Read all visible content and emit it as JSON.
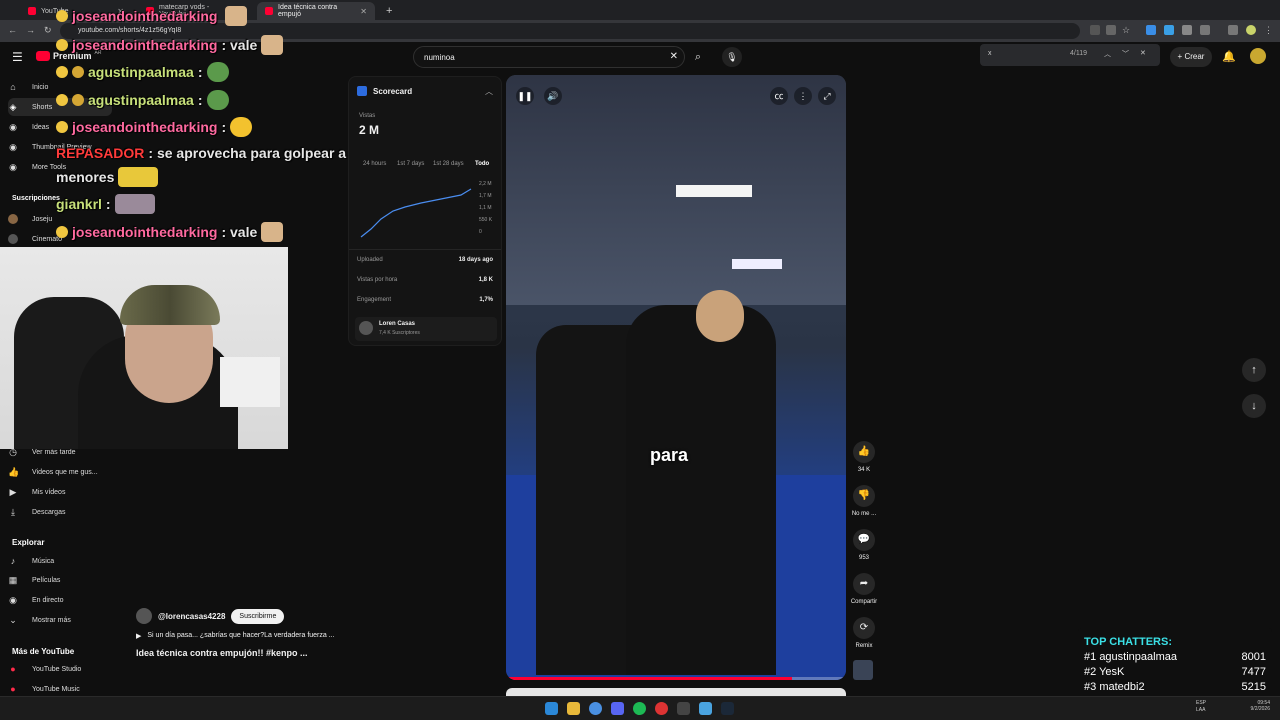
{
  "browser": {
    "tabs": [
      {
        "label": "YouTube"
      },
      {
        "label": "matecarp vods - YouTube"
      },
      {
        "label": "Idea técnica contra empujó"
      }
    ],
    "url": "youtube.com/shorts/4z1z56gYqI8",
    "find": {
      "query": "x",
      "count": "4/119"
    }
  },
  "yt": {
    "logo": "Premium",
    "logo_sup": "AR",
    "search": "numinoa",
    "create": "Crear"
  },
  "sidebar": {
    "items": [
      {
        "label": "Inicio",
        "icon": "home-icon"
      },
      {
        "label": "Shorts",
        "icon": "shorts-icon"
      },
      {
        "label": "Ideas",
        "icon": "ideas-icon"
      },
      {
        "label": "Thumbnail Preview",
        "icon": "ext-icon"
      },
      {
        "label": "More Tools",
        "icon": "ext-icon"
      }
    ],
    "subs_head": "Suscripciones",
    "subs": [
      {
        "label": "Joseju"
      },
      {
        "label": "Cinemato"
      }
    ],
    "you": [
      {
        "label": "Ver más tarde"
      },
      {
        "label": "Videos que me gus..."
      },
      {
        "label": "Mis vídeos"
      },
      {
        "label": "Descargas"
      }
    ],
    "explore_head": "Explorar",
    "explore": [
      {
        "label": "Música"
      },
      {
        "label": "Películas"
      },
      {
        "label": "En directo"
      },
      {
        "label": "Mostrar más"
      }
    ],
    "more_head": "Más de YouTube",
    "more": [
      {
        "label": "YouTube Studio"
      },
      {
        "label": "YouTube Music"
      }
    ]
  },
  "chat": [
    {
      "user": "joseandointhedarking",
      "msg": ""
    },
    {
      "user": "joseandointhedarking",
      "msg": ": vale"
    },
    {
      "user": "agustinpaalmaa",
      "msg": ":"
    },
    {
      "user": "agustinpaalmaa",
      "msg": ":"
    },
    {
      "user": "joseandointhedarking",
      "msg": ":"
    },
    {
      "user": "REPASADOR",
      "msg": ": se aprovecha para golpear a"
    },
    {
      "user": "",
      "msg": "menores"
    },
    {
      "user": "giankrl",
      "msg": ":"
    },
    {
      "user": "joseandointhedarking",
      "msg": ": vale"
    }
  ],
  "scorecard": {
    "title": "Scorecard",
    "views_label": "Vistas",
    "views": "2 M",
    "ranges": [
      "24 hours",
      "1st 7 days",
      "1st 28 days",
      "Todo"
    ],
    "y_ticks": [
      "2,2 M",
      "1,7 M",
      "1,1 M",
      "550 K",
      "0"
    ],
    "rows": [
      {
        "label": "Uploaded",
        "value": "18 days ago"
      },
      {
        "label": "Vistas por hora",
        "value": "1,8 K"
      },
      {
        "label": "Engagement",
        "value": "1,7%"
      }
    ],
    "channel": "Loren Casas",
    "channel_subs": "7,4 K Suscriptores"
  },
  "video": {
    "caption": "para",
    "progress": 0.84
  },
  "actions": [
    {
      "label": "34 K",
      "icon": "like-icon"
    },
    {
      "label": "No me ...",
      "icon": "dislike-icon"
    },
    {
      "label": "953",
      "icon": "comment-icon"
    },
    {
      "label": "Compartir",
      "icon": "share-icon"
    },
    {
      "label": "Remix",
      "icon": "remix-icon"
    }
  ],
  "channel": {
    "handle": "@lorencasas4228",
    "subscribe": "Suscribirme",
    "description": "Si un día pasa... ¿sabrías que hacer?La verdadera fuerza ...",
    "title": "Idea técnica contra empujón!! #kenpo ..."
  },
  "top_chatters": {
    "title": "TOP CHATTERS:",
    "rows": [
      {
        "rank": "#1",
        "name": "agustinpaalmaa",
        "count": "8001"
      },
      {
        "rank": "#2",
        "name": "YesK",
        "count": "7477"
      },
      {
        "rank": "#3",
        "name": "matedbi2",
        "count": "5215"
      }
    ]
  },
  "taskbar": {
    "lang": "ESP\nLAA",
    "time": "09:54",
    "date": "9/2/2026"
  }
}
